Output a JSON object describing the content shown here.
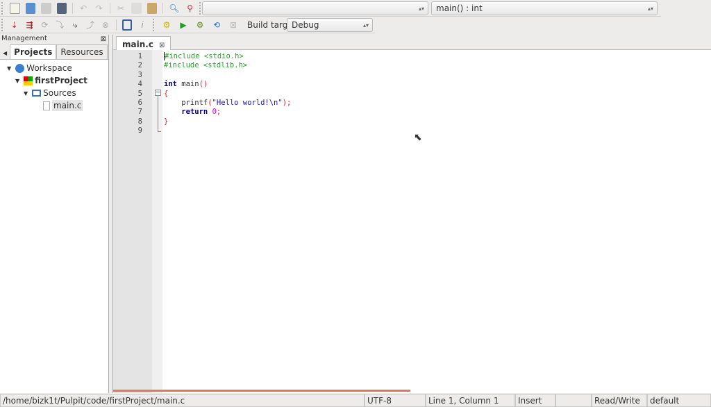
{
  "toolbar": {
    "function_combo": "main() : int",
    "build_target_label": "Build target:",
    "build_target_value": "Debug"
  },
  "management": {
    "title": "Management",
    "tabs": [
      "Projects",
      "Resources"
    ],
    "tree": {
      "workspace": "Workspace",
      "project": "firstProject",
      "folder": "Sources",
      "file": "main.c"
    }
  },
  "editor": {
    "tab": "main.c",
    "line_numbers": [
      "1",
      "2",
      "3",
      "4",
      "5",
      "6",
      "7",
      "8",
      "9"
    ]
  },
  "status": {
    "path": "/home/bizk1t/Pulpit/code/firstProject/main.c",
    "encoding": "UTF-8",
    "position": "Line 1, Column 1",
    "mode": "Insert",
    "blank": "",
    "access": "Read/Write",
    "profile": "default"
  },
  "colors": {
    "preprocessor": "#2ea02e",
    "keyword": "#00007f",
    "string": "#1414c8",
    "number": "#e000e0",
    "operator": "#e02020"
  }
}
